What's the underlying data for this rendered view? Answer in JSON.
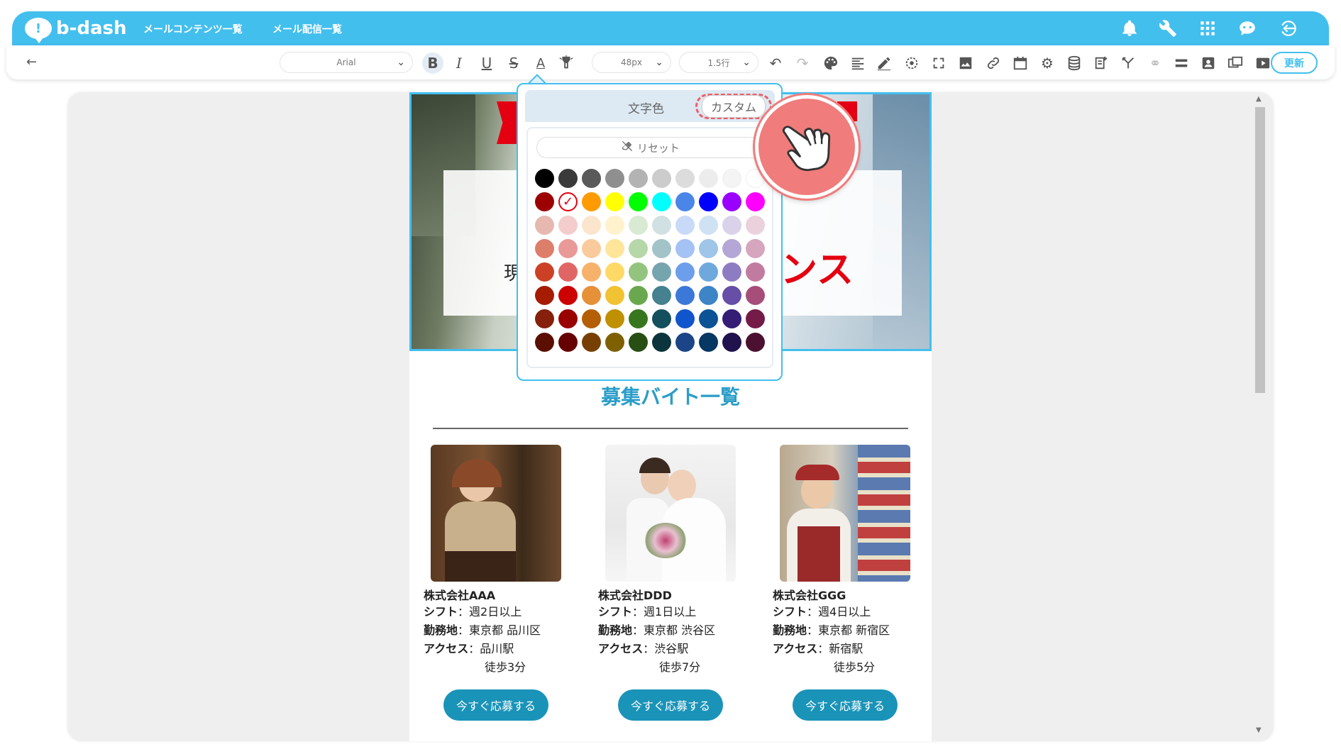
{
  "header": {
    "logo_text": "b-dash",
    "nav": [
      "メールコンテンツ一覧",
      "メール配信一覧"
    ],
    "icons": [
      "bell-icon",
      "wrench-icon",
      "grid-icon",
      "chat-bot-icon",
      "sign-in-icon"
    ]
  },
  "toolbar": {
    "font_family": "Arial",
    "font_size": "48px",
    "line_height": "1.5行",
    "update_label": "更新"
  },
  "color_popup": {
    "tab_text_color": "文字色",
    "tab_custom": "カスタム",
    "reset_label": "リセット",
    "selected_color": "#e40010",
    "swatches": [
      [
        "#000000",
        "#3a3a3a",
        "#5a5a5a",
        "#8f8f8f",
        "#b3b3b3",
        "#cccccc",
        "#dcdcdc",
        "#ececec",
        "#f4f4f4",
        "#ffffff"
      ],
      [
        "#9c0000",
        "#e40010",
        "#ff9a00",
        "#ffff00",
        "#00ff00",
        "#00ffff",
        "#4a86e8",
        "#0000ff",
        "#9900ff",
        "#ff00ff"
      ],
      [
        "#e6b8af",
        "#f4cccc",
        "#fce5cd",
        "#fff2cc",
        "#d9ead3",
        "#d0e0e3",
        "#c9daf8",
        "#cfe2f3",
        "#d9d2e9",
        "#ead1dc"
      ],
      [
        "#dd7e6b",
        "#ea9999",
        "#f9cb9c",
        "#ffe599",
        "#b6d7a8",
        "#a2c4c9",
        "#a4c2f4",
        "#9fc5e8",
        "#b4a7d6",
        "#d5a6bd"
      ],
      [
        "#cc4125",
        "#e06666",
        "#f6b26b",
        "#ffd966",
        "#93c47d",
        "#76a5af",
        "#6d9eeb",
        "#6fa8dc",
        "#8e7cc3",
        "#c27ba0"
      ],
      [
        "#a61c00",
        "#cc0000",
        "#e69138",
        "#f1c232",
        "#6aa84f",
        "#45818e",
        "#3c78d8",
        "#3d85c6",
        "#674ea7",
        "#a64d79"
      ],
      [
        "#85200c",
        "#990000",
        "#b45f06",
        "#bf9000",
        "#38761d",
        "#134f5c",
        "#1155cc",
        "#0b5394",
        "#351c75",
        "#741b47"
      ],
      [
        "#5b0f00",
        "#660000",
        "#783f04",
        "#7f6000",
        "#274e13",
        "#0c343d",
        "#1c4587",
        "#073763",
        "#20124d",
        "#4c1130"
      ]
    ]
  },
  "email": {
    "hero_text_left": "現",
    "hero_text_right": "ンス",
    "list_title": "募集バイト一覧",
    "jobs": [
      {
        "company": "株式会社AAA",
        "shift_label": "シフト",
        "shift": "：週2日以上",
        "place_label": "勤務地",
        "place": "：東京都 品川区",
        "access_label": "アクセス",
        "access": "：品川駅",
        "walk": "徒歩3分",
        "button": "今すぐ応募する"
      },
      {
        "company": "株式会社DDD",
        "shift_label": "シフト",
        "shift": "：週1日以上",
        "place_label": "勤務地",
        "place": "：東京都 渋谷区",
        "access_label": "アクセス",
        "access": "：渋谷駅",
        "walk": "徒歩7分",
        "button": "今すぐ応募する"
      },
      {
        "company": "株式会社GGG",
        "shift_label": "シフト",
        "shift": "：週4日以上",
        "place_label": "勤務地",
        "place": "：東京都 新宿区",
        "access_label": "アクセス",
        "access": "：新宿駅",
        "walk": "徒歩5分",
        "button": "今すぐ応募する"
      }
    ]
  },
  "colors": {
    "brand": "#43bfee",
    "title": "#2b9dc8",
    "button": "#1a93b8",
    "highlight": "#ee5d66"
  }
}
